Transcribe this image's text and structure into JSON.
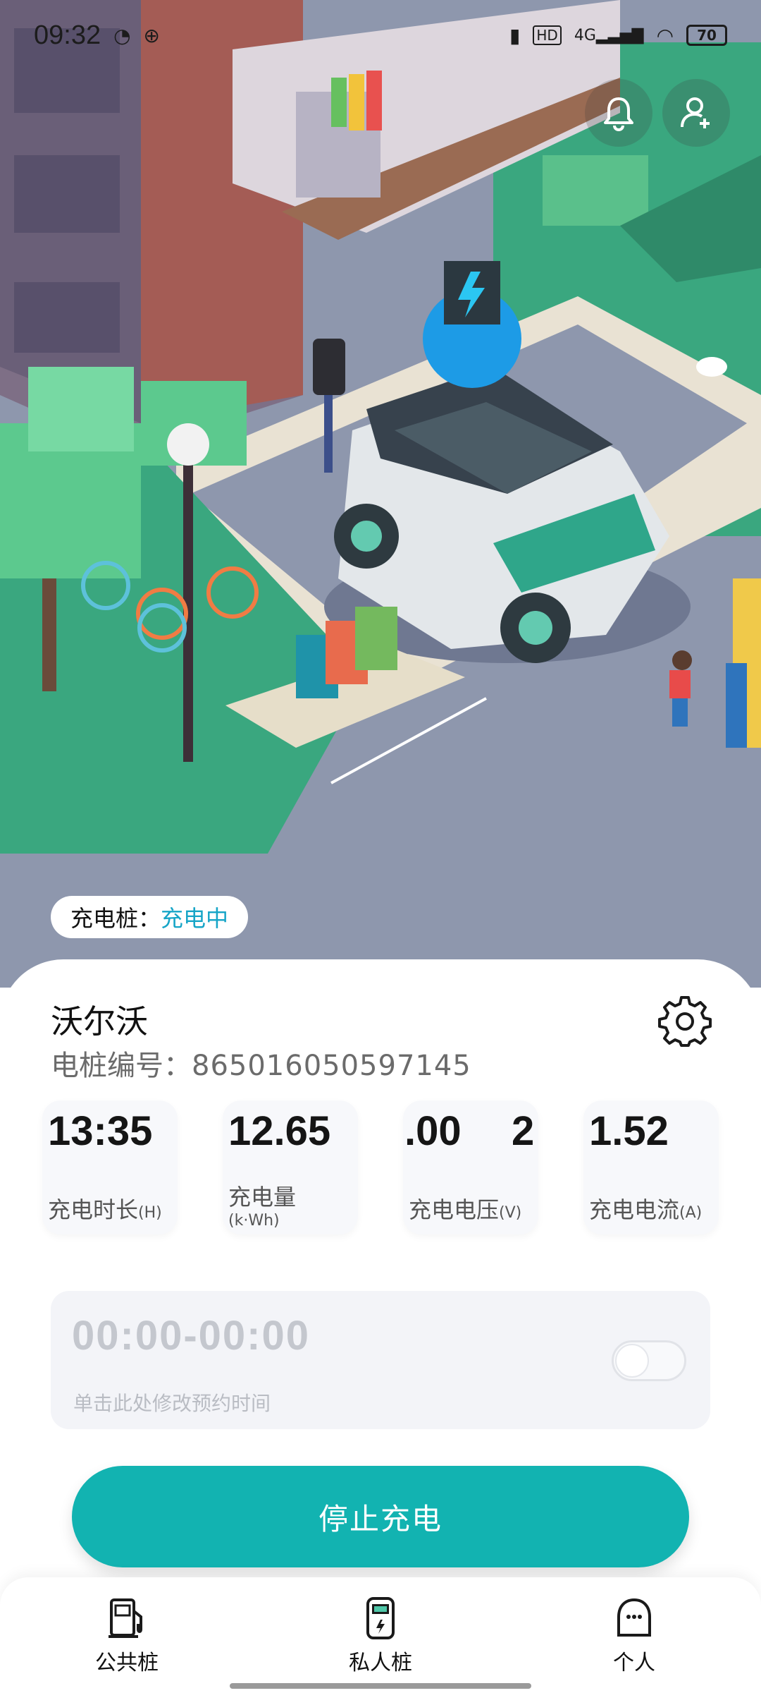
{
  "status_bar": {
    "time": "09:32",
    "battery": "70",
    "network": "4G",
    "hd": "HD"
  },
  "header": {
    "status_prefix": "充电桩：",
    "status_value": "充电中"
  },
  "device": {
    "name": "沃尔沃",
    "code_label": "电桩编号：",
    "code": "865016050597145"
  },
  "stats": [
    {
      "value": "13:35",
      "label": "充电时长",
      "unit": "(H)"
    },
    {
      "value": "12.65",
      "label": "充电量",
      "unit": "(k·Wh)"
    },
    {
      "value": ".00",
      "value_extra": "2",
      "label": "充电电压",
      "unit": "(V)"
    },
    {
      "value": "1.52",
      "label": "充电电流",
      "unit": "(A)"
    }
  ],
  "schedule": {
    "time": "00:00-00:00",
    "hint": "单击此处修改预约时间",
    "enabled": false
  },
  "actions": {
    "stop_label": "停止充电"
  },
  "nav": [
    {
      "label": "公共桩",
      "icon": "public-charger-icon"
    },
    {
      "label": "私人桩",
      "icon": "private-charger-icon"
    },
    {
      "label": "个人",
      "icon": "profile-icon"
    }
  ],
  "colors": {
    "accent": "#12b3b1",
    "status_text": "#16a5c7",
    "grass": "#3aa77f",
    "road": "#8e97ad"
  }
}
